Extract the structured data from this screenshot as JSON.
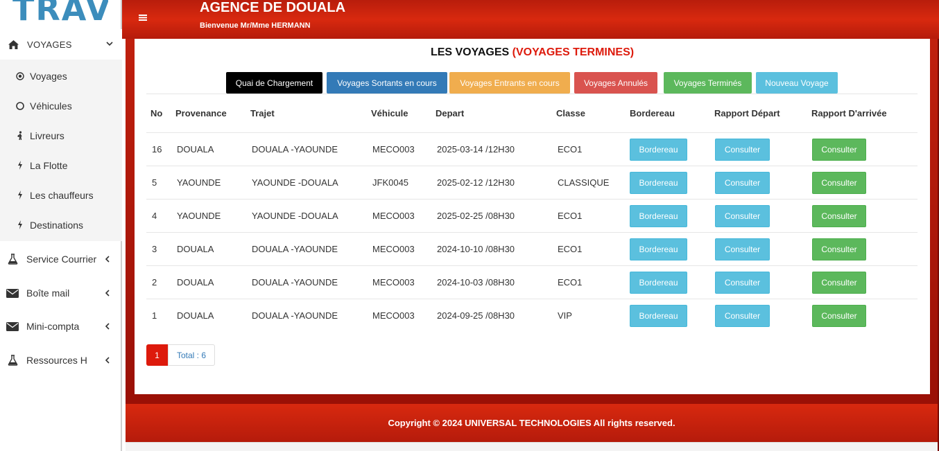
{
  "logo": {
    "text": "TRAV"
  },
  "sidebar": {
    "main": {
      "label": "VOYAGES",
      "icon": "home-icon"
    },
    "submenu": [
      {
        "label": "Voyages",
        "icon": "dot-circle-icon"
      },
      {
        "label": "Véhicules",
        "icon": "circle-icon"
      },
      {
        "label": "Livreurs",
        "icon": "person-walking-icon"
      },
      {
        "label": "La Flotte",
        "icon": "bolt-icon"
      },
      {
        "label": "Les chauffeurs",
        "icon": "bolt-icon"
      },
      {
        "label": "Destinations",
        "icon": "bolt-icon"
      }
    ],
    "items": [
      {
        "label": "Service Courrier",
        "icon": "flask-icon"
      },
      {
        "label": "Boîte mail",
        "icon": "envelope-icon"
      },
      {
        "label": "Mini-compta",
        "icon": "envelope-icon"
      },
      {
        "label": "Ressources H",
        "icon": "flask-icon"
      }
    ]
  },
  "header": {
    "agency": "AGENCE DE DOUALA",
    "welcome": "Bienvenue Mr/Mme HERMANN"
  },
  "page": {
    "title_main": "LES VOYAGES",
    "title_status": "(VOYAGES TERMINES)"
  },
  "actions": {
    "quai": "Quai de Chargement",
    "sortants": "Voyages Sortants en cours",
    "entrants": "Voyages Entrants en cours",
    "annules": "Voyages Annulés",
    "termines": "Voyages Terminés",
    "nouveau": "Nouveau Voyage"
  },
  "table": {
    "headers": [
      "No",
      "Provenance",
      "Trajet",
      "Véhicule",
      "Depart",
      "Classe",
      "Bordereau",
      "Rapport Départ",
      "Rapport D'arrivée"
    ],
    "rows": [
      {
        "no": "16",
        "provenance": "DOUALA",
        "trajet": "DOUALA -YAOUNDE",
        "vehicule": "MECO003",
        "depart": "2025-03-14 /12H30",
        "classe": "ECO1",
        "bordereau": "Bordereau",
        "rapport_depart": "Consulter",
        "rapport_arrivee": "Consulter"
      },
      {
        "no": "5",
        "provenance": "YAOUNDE",
        "trajet": "YAOUNDE -DOUALA",
        "vehicule": "JFK0045",
        "depart": "2025-02-12 /12H30",
        "classe": "CLASSIQUE",
        "bordereau": "Bordereau",
        "rapport_depart": "Consulter",
        "rapport_arrivee": "Consulter"
      },
      {
        "no": "4",
        "provenance": "YAOUNDE",
        "trajet": "YAOUNDE -DOUALA",
        "vehicule": "MECO003",
        "depart": "2025-02-25 /08H30",
        "classe": "ECO1",
        "bordereau": "Bordereau",
        "rapport_depart": "Consulter",
        "rapport_arrivee": "Consulter"
      },
      {
        "no": "3",
        "provenance": "DOUALA",
        "trajet": "DOUALA -YAOUNDE",
        "vehicule": "MECO003",
        "depart": "2024-10-10 /08H30",
        "classe": "ECO1",
        "bordereau": "Bordereau",
        "rapport_depart": "Consulter",
        "rapport_arrivee": "Consulter"
      },
      {
        "no": "2",
        "provenance": "DOUALA",
        "trajet": "DOUALA -YAOUNDE",
        "vehicule": "MECO003",
        "depart": "2024-10-03 /08H30",
        "classe": "ECO1",
        "bordereau": "Bordereau",
        "rapport_depart": "Consulter",
        "rapport_arrivee": "Consulter"
      },
      {
        "no": "1",
        "provenance": "DOUALA",
        "trajet": "DOUALA -YAOUNDE",
        "vehicule": "MECO003",
        "depart": "2024-09-25 /08H30",
        "classe": "VIP",
        "bordereau": "Bordereau",
        "rapport_depart": "Consulter",
        "rapport_arrivee": "Consulter"
      }
    ]
  },
  "pagination": {
    "current": "1",
    "total": "Total : 6"
  },
  "footer": {
    "text": "Copyright © 2024 UNIVERSAL TECHNOLOGIES All rights reserved."
  },
  "colors": {
    "brand_red": "#dd1a0c",
    "header_red": "#d8290f",
    "primary": "#337ab7",
    "info": "#5bc0de",
    "success": "#5cb85c",
    "warning": "#f0ad4e",
    "danger": "#d9534f"
  }
}
